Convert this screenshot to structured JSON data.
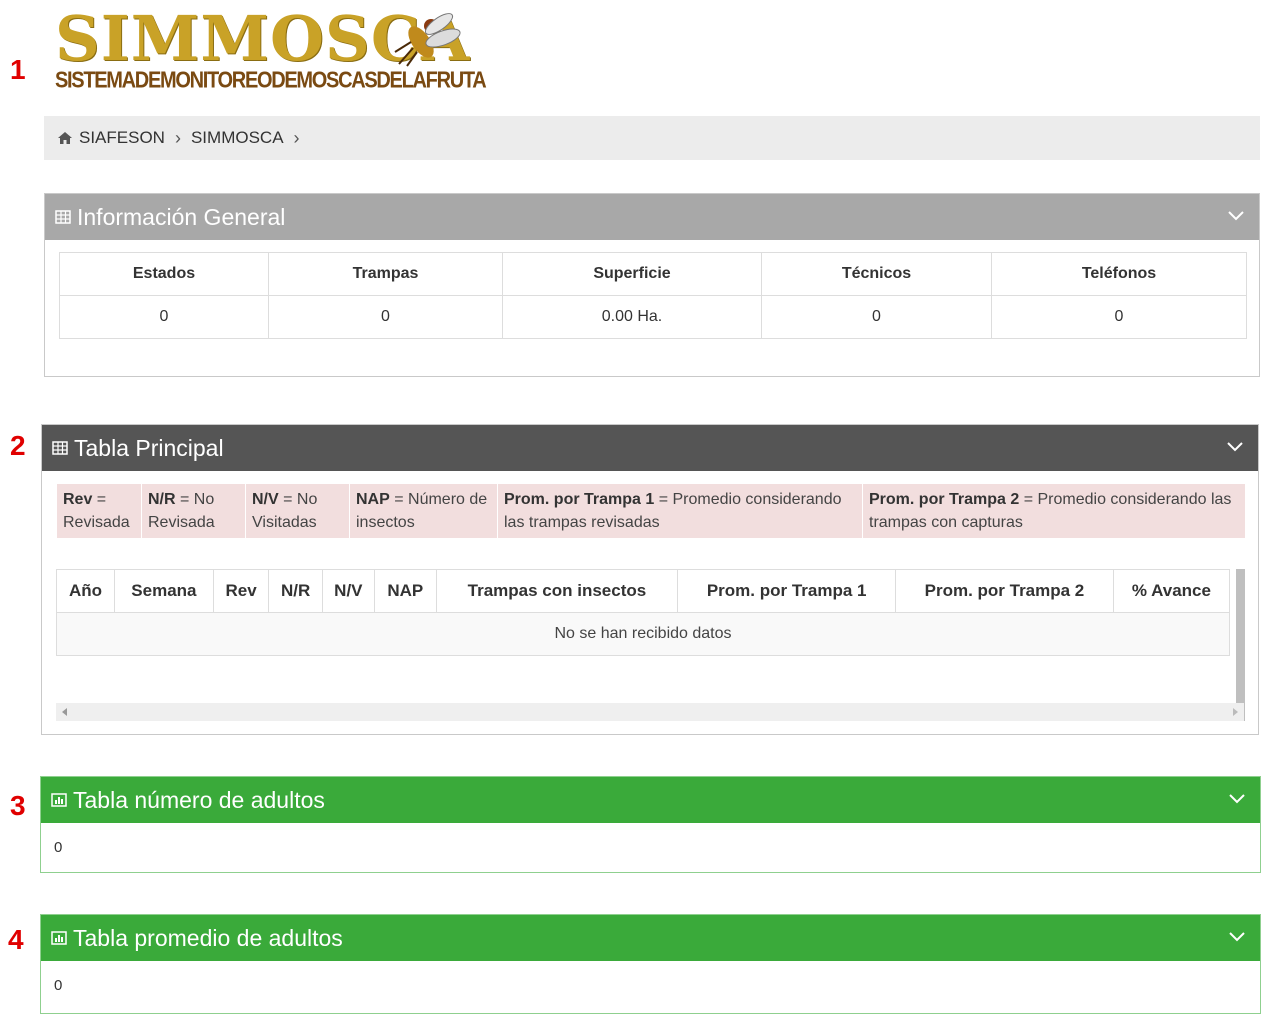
{
  "markers": [
    "1",
    "2",
    "3",
    "4"
  ],
  "logo": {
    "title": "SIMMOSCA",
    "subtitle": "SISTEMADEMONITOREODEMOSCASDELAFRUTA"
  },
  "breadcrumb": {
    "items": [
      "SIAFESON",
      "SIMMOSCA"
    ],
    "separator": "›"
  },
  "info_general": {
    "title": "Información General",
    "headers": [
      "Estados",
      "Trampas",
      "Superficie",
      "Técnicos",
      "Teléfonos"
    ],
    "values": [
      "0",
      "0",
      "0.00 Ha.",
      "0",
      "0"
    ]
  },
  "tabla_principal": {
    "title": "Tabla Principal",
    "legend": [
      {
        "key": "Rev",
        "text": " = Revisada"
      },
      {
        "key": "N/R",
        "text": " = No Revisada"
      },
      {
        "key": "N/V",
        "text": " = No Visitadas"
      },
      {
        "key": "NAP",
        "text": " = Número de insectos"
      },
      {
        "key": "Prom. por Trampa 1",
        "text": " = Promedio considerando las trampas revisadas"
      },
      {
        "key": "Prom. por Trampa 2",
        "text": " = Promedio considerando las trampas con capturas"
      }
    ],
    "headers": [
      "Año",
      "Semana",
      "Rev",
      "N/R",
      "N/V",
      "NAP",
      "Trampas con insectos",
      "Prom. por Trampa 1",
      "Prom. por Trampa 2",
      "% Avance"
    ],
    "empty_message": "No se han recibido datos"
  },
  "tabla_numero_adultos": {
    "title": "Tabla número de adultos",
    "value": "0"
  },
  "tabla_promedio_adultos": {
    "title": "Tabla promedio de adultos",
    "value": "0"
  },
  "colors": {
    "logo_gold": "#c9a227",
    "logo_brown": "#7a4a12",
    "panel_gray": "#a8a8a8",
    "panel_dark": "#555555",
    "panel_green": "#3aaa3a",
    "legend_bg": "#f2dede",
    "marker_red": "#e00000"
  },
  "icons": {
    "breadcrumb_home": "home-icon",
    "info_header": "table-icon",
    "principal_header": "table-icon",
    "adultos_header": "bar-chart-icon",
    "collapse": "chevron-down-icon"
  }
}
